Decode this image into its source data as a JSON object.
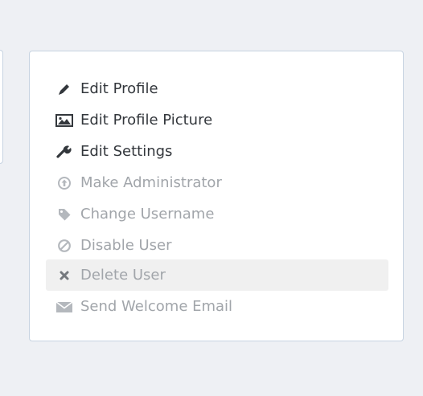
{
  "colors": {
    "background": "#eef0f4",
    "panel_border": "#c7d3e1",
    "enabled_text": "#33373c",
    "disabled_text": "#a1a5aa",
    "hover_bg": "#f0f0f0"
  },
  "menu": {
    "items": [
      {
        "label": "Edit Profile",
        "icon": "pencil-icon",
        "enabled": true,
        "hovered": false
      },
      {
        "label": "Edit Profile Picture",
        "icon": "picture-icon",
        "enabled": true,
        "hovered": false
      },
      {
        "label": "Edit Settings",
        "icon": "wrench-icon",
        "enabled": true,
        "hovered": false
      },
      {
        "label": "Make Administrator",
        "icon": "admin-icon",
        "enabled": false,
        "hovered": false
      },
      {
        "label": "Change Username",
        "icon": "tag-icon",
        "enabled": false,
        "hovered": false
      },
      {
        "label": "Disable User",
        "icon": "ban-icon",
        "enabled": false,
        "hovered": false
      },
      {
        "label": "Delete User",
        "icon": "close-icon",
        "enabled": false,
        "hovered": true
      },
      {
        "label": "Send Welcome Email",
        "icon": "envelope-icon",
        "enabled": false,
        "hovered": false
      }
    ]
  }
}
